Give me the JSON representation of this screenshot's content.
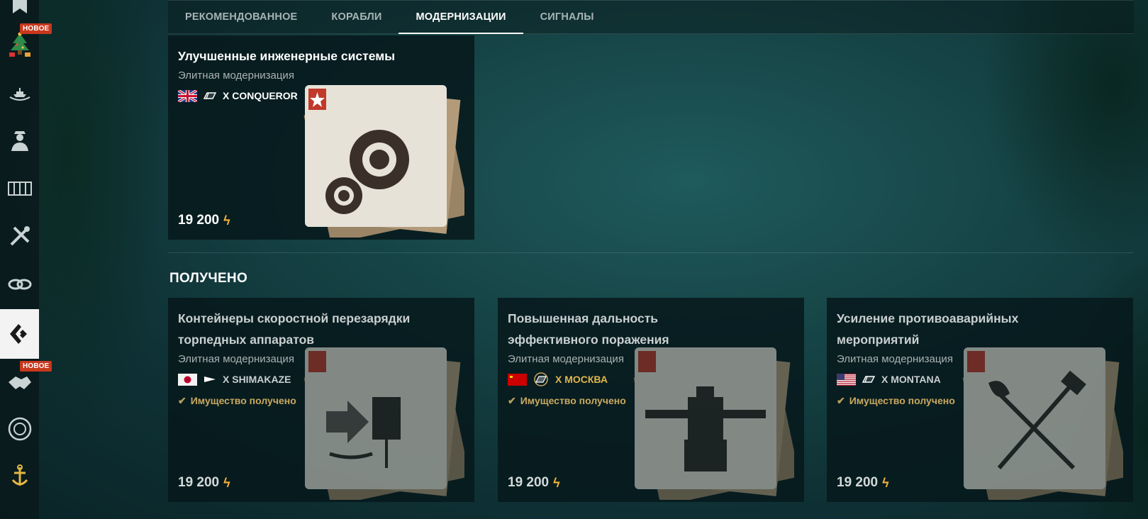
{
  "tabs": [
    {
      "label": "РЕКОМЕНДОВАННОЕ",
      "active": false
    },
    {
      "label": "КОРАБЛИ",
      "active": false
    },
    {
      "label": "МОДЕРНИЗАЦИИ",
      "active": true
    },
    {
      "label": "СИГНАЛЫ",
      "active": false
    }
  ],
  "sidebar": {
    "new_badge": "НОВОЕ",
    "items": [
      {
        "icon": "bookmark-icon"
      },
      {
        "icon": "christmas-tree-icon",
        "badge": "НОВОЕ"
      },
      {
        "icon": "ships-laurel-icon"
      },
      {
        "icon": "commander-icon"
      },
      {
        "icon": "containers-icon"
      },
      {
        "icon": "tools-icon"
      },
      {
        "icon": "chain-icon"
      },
      {
        "icon": "armory-icon",
        "active": true
      },
      {
        "icon": "handshake-icon",
        "badge": "НОВОЕ"
      },
      {
        "icon": "coin-icon"
      },
      {
        "icon": "anchor-laurel-icon"
      }
    ]
  },
  "featured": {
    "title": "Улучшенные инженерные системы",
    "subtitle": "Элитная модернизация",
    "ship": "X CONQUEROR",
    "nation": "uk",
    "price": "19 200",
    "currency_icon": "coal-icon"
  },
  "received_section": {
    "title": "ПОЛУЧЕНО",
    "received_label": "Имущество получено",
    "cards": [
      {
        "title": "Контейнеры скоростной перезарядки торпедных аппаратов",
        "subtitle": "Элитная модернизация",
        "ship": "X SHIMAKAZE",
        "nation": "japan",
        "price": "19 200",
        "art": "torpedo"
      },
      {
        "title": "Повышенная дальность эффективного поражения",
        "subtitle": "Элитная модернизация",
        "ship": "X МОСКВА",
        "nation": "ussr",
        "price": "19 200",
        "art": "turret"
      },
      {
        "title": "Усиление противоаварийных мероприятий",
        "subtitle": "Элитная модернизация",
        "ship": "X MONTANA",
        "nation": "usa",
        "price": "19 200",
        "art": "axes"
      }
    ]
  },
  "colors": {
    "accent_gold": "#c9a95e",
    "coal": "#f3b33d",
    "badge_red": "#c8381d"
  }
}
